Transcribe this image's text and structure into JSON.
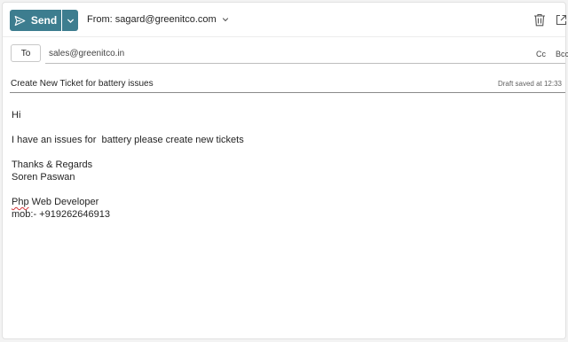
{
  "toolbar": {
    "send_label": "Send",
    "from_label": "From: sagard@greenitco.com"
  },
  "recipients": {
    "to_label": "To",
    "to_value": "sales@greenitco.in",
    "cc_label": "Cc",
    "bcc_label": "Bcc"
  },
  "subject": {
    "value": "Create New Ticket for battery issues",
    "draft_status": "Draft saved at 12:33"
  },
  "message": {
    "greeting": "Hi",
    "line1": "I have an issues for  battery please create new tickets",
    "closing": "Thanks & Regards",
    "name": "Soren Paswan",
    "title_word1": "Php",
    "title_rest": " Web Developer",
    "mobile": "mob:- +919262646913"
  },
  "colors": {
    "accent": "#3d7d8f",
    "spellcheck": "#d13438"
  },
  "icons": [
    "send-icon",
    "chevron-down-icon",
    "trash-icon",
    "popout-icon"
  ]
}
